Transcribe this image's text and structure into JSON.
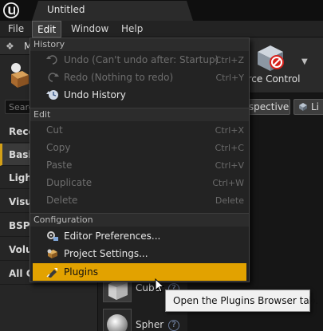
{
  "window": {
    "tab_title": "Untitled"
  },
  "menubar": {
    "items": [
      "File",
      "Edit",
      "Window",
      "Help"
    ]
  },
  "left_panel": {
    "header_label": "M",
    "search_placeholder": "Searc",
    "categories": [
      "Rece",
      "Basic",
      "Light",
      "Visua",
      "BSP",
      "Volum",
      "All Cl"
    ]
  },
  "assets": [
    {
      "name": "Cube",
      "help": "?"
    },
    {
      "name": "Spher",
      "help": "?"
    }
  ],
  "toolbar": {
    "source_control_label": "urce Control",
    "dropdown_arrow": "▼"
  },
  "viewport": {
    "perspective_label": "rspective",
    "lit_label": "Li"
  },
  "edit_menu": {
    "sections": [
      {
        "header": "History",
        "items": [
          {
            "label": "Undo (Can't undo after: Startup)",
            "shortcut": "Ctrl+Z",
            "enabled": false,
            "icon": "undo-icon"
          },
          {
            "label": "Redo (Nothing to redo)",
            "shortcut": "Ctrl+Y",
            "enabled": false,
            "icon": "redo-icon"
          },
          {
            "label": "Undo History",
            "shortcut": "",
            "enabled": true,
            "icon": "undo-history-icon"
          }
        ]
      },
      {
        "header": "Edit",
        "items": [
          {
            "label": "Cut",
            "shortcut": "Ctrl+X",
            "enabled": false
          },
          {
            "label": "Copy",
            "shortcut": "Ctrl+C",
            "enabled": false
          },
          {
            "label": "Paste",
            "shortcut": "Ctrl+V",
            "enabled": false
          },
          {
            "label": "Duplicate",
            "shortcut": "Ctrl+W",
            "enabled": false
          },
          {
            "label": "Delete",
            "shortcut": "Delete",
            "enabled": false
          }
        ]
      },
      {
        "header": "Configuration",
        "items": [
          {
            "label": "Editor Preferences...",
            "shortcut": "",
            "enabled": true,
            "icon": "editor-preferences-icon"
          },
          {
            "label": "Project Settings...",
            "shortcut": "",
            "enabled": true,
            "icon": "project-settings-icon"
          },
          {
            "label": "Plugins",
            "shortcut": "",
            "enabled": true,
            "icon": "plugins-icon",
            "highlighted": true
          }
        ]
      }
    ]
  },
  "tooltip": {
    "text": "Open the Plugins Browser tab."
  },
  "colors": {
    "highlight": "#e2a200",
    "selected_category_accent": "#d4a017"
  }
}
